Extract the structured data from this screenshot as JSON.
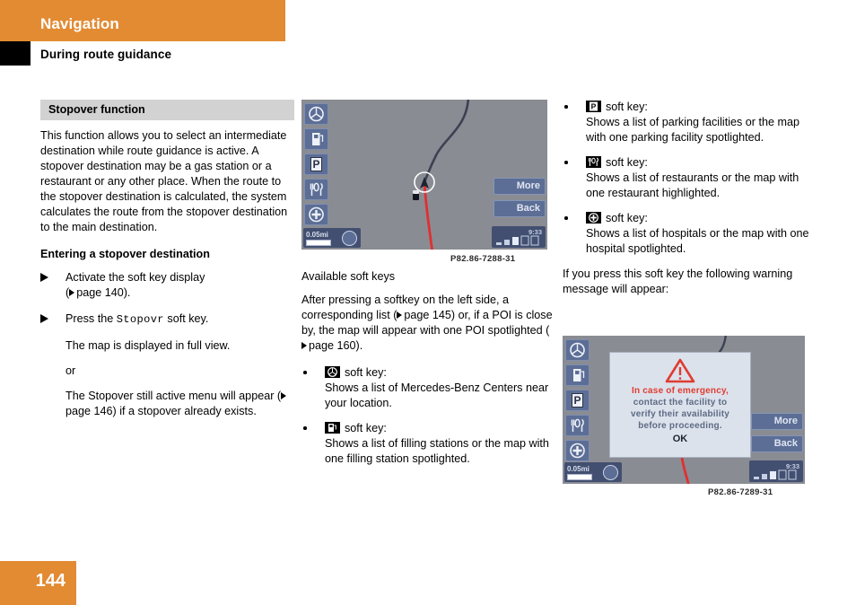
{
  "header": {
    "title": "Navigation",
    "subtitle": "During route guidance",
    "accent_color": "#e28b33"
  },
  "footer": {
    "page_number": "144"
  },
  "column_1": {
    "section_head": "Stopover function",
    "intro": "This function allows you to select an intermediate destination while route guidance is active. A stopover destination may be a gas station or a restaurant or any other place. When the route to the stopover destination is calculated, the system calculates the route from the stopover destination to the main destination.",
    "sub_head": "Entering a stopover destination",
    "step_1_a": "Activate the soft key display",
    "step_1_b": "page 140).",
    "step_2_pre": "Press the ",
    "step_2_key": "Stopovr",
    "step_2_post": " soft key.",
    "step_2_note": "The map is displayed in full view.",
    "or_label": "or",
    "step_2_alt_a": "The Stopover still active menu will appear (",
    "step_2_alt_b": "page 146) if a stopover already exists."
  },
  "column_2": {
    "caption": "P82.86-7288-31",
    "heading": "Available soft keys",
    "paragraph_a": "After pressing a softkey on the left side, a corresponding list (",
    "paragraph_b": "page 145) or, if a POI is close by, the map will appear with one POI spotlighted (",
    "paragraph_c": "page 160).",
    "bullets": [
      {
        "icon": "mercedes-star-icon",
        "key_label": "soft key:",
        "description": "Shows a list of Mercedes-Benz Centers near your location."
      },
      {
        "icon": "fuel-pump-icon",
        "key_label": "soft key:",
        "description": "Shows a list of filling stations or the map with one filling station spotlighted."
      }
    ]
  },
  "column_3": {
    "caption": "P82.86-7289-31",
    "bullets": [
      {
        "icon": "parking-icon",
        "key_label": "soft key:",
        "description": "Shows a list of parking facilities or the map with one parking facility spotlighted."
      },
      {
        "icon": "restaurant-icon",
        "key_label": "soft key:",
        "description": "Shows a list of restaurants or the map with one restaurant highlighted."
      },
      {
        "icon": "hospital-icon",
        "key_label": "soft key:",
        "description": "Shows a list of hospitals or the map with one hospital spotlighted."
      }
    ],
    "closing_paragraph": "If you press this soft key the following warning message will appear:"
  },
  "nav_display": {
    "soft_keys_left": [
      "mercedes-star-icon",
      "fuel-pump-icon",
      "parking-icon",
      "restaurant-icon",
      "hospital-icon"
    ],
    "soft_key_more": "More",
    "soft_key_back": "Back",
    "scale": "0.05mi",
    "time": "9:33",
    "screen_colors": {
      "background": "#8a8c93",
      "soft_key": "#5c6e95",
      "route_red": "#e03030",
      "road_dark": "#3c4252"
    }
  },
  "warning_dialog": {
    "line_1": "In case of emergency,",
    "line_2": "contact the facility to",
    "line_3": "verify their availability",
    "line_4": "before proceeding.",
    "ok_label": "OK",
    "warning_color": "#e03c31"
  }
}
